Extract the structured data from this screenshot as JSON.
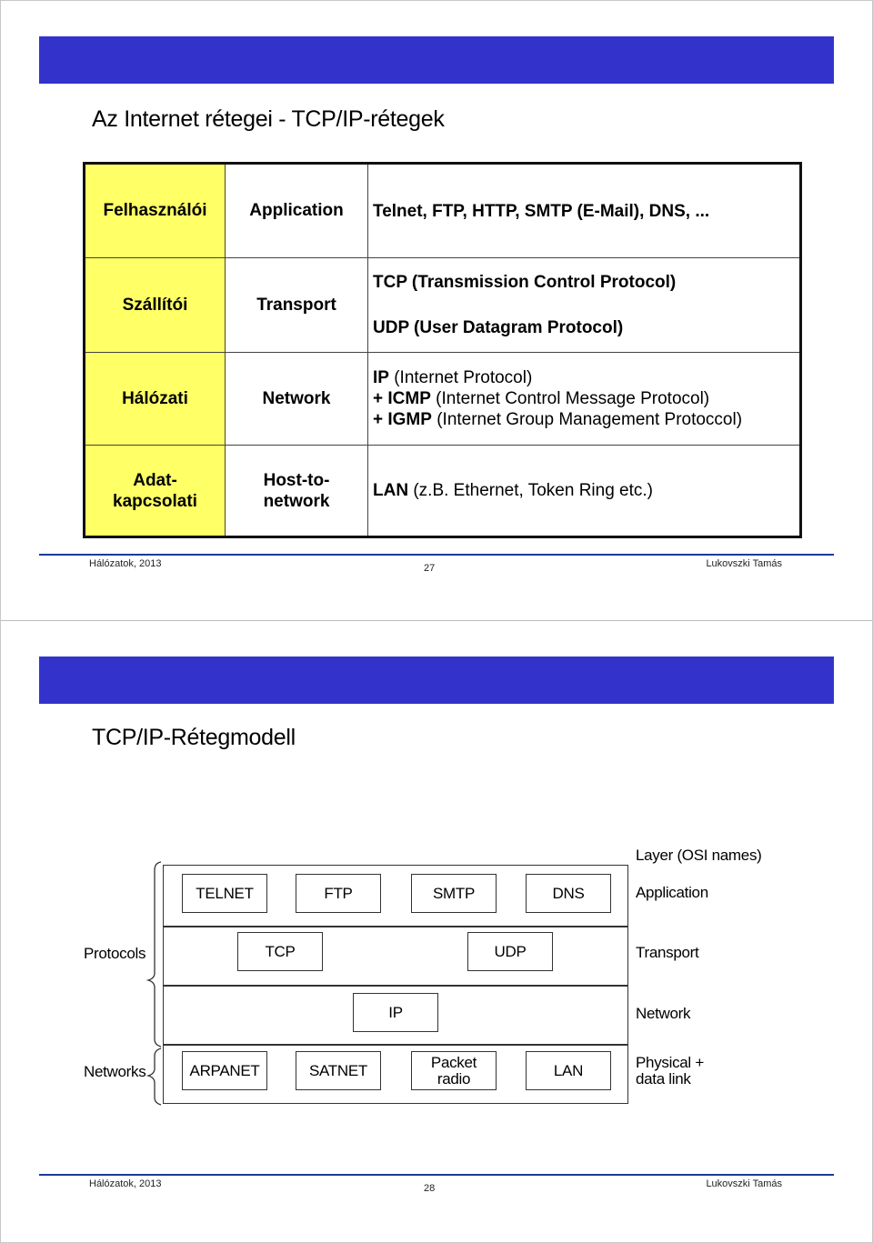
{
  "slides": [
    {
      "title": "Az Internet rétegei - TCP/IP-rétegek",
      "table": {
        "rows": [
          {
            "hungarian": "Felhasználói",
            "english": "Application",
            "protocols": [
              "Telnet, FTP, HTTP, SMTP (E-Mail), DNS, ..."
            ]
          },
          {
            "hungarian": "Szállítói",
            "english": "Transport",
            "protocols": [
              "TCP (Transmission Control Protocol)",
              "UDP (User Datagram Protocol)"
            ]
          },
          {
            "hungarian": "Hálózati",
            "english": "Network",
            "protocols": [
              {
                "prefix": "IP",
                "rest": " (Internet Protocol)"
              },
              {
                "prefix": "+ ICMP",
                "rest": " (Internet Control Message Protocol)"
              },
              {
                "prefix": "+ IGMP",
                "rest": " (Internet  Group Management Protoccol)"
              }
            ]
          },
          {
            "hungarian_line1": "Adat-",
            "hungarian_line2": "kapcsolati",
            "english_line1": "Host-to-",
            "english_line2": "network",
            "protocols": [
              {
                "prefix": "LAN",
                "rest": " (z.B. Ethernet, Token Ring etc.)"
              }
            ]
          }
        ]
      },
      "footer": {
        "left": "Hálózatok, 2013",
        "page": "27",
        "right": "Lukovszki Tamás"
      }
    },
    {
      "title": "TCP/IP-Rétegmodell",
      "diagram": {
        "header": "Layer (OSI names)",
        "layers": [
          {
            "name": "Application",
            "boxes": [
              "TELNET",
              "FTP",
              "SMTP",
              "DNS"
            ]
          },
          {
            "name": "Transport",
            "boxes": [
              "TCP",
              "UDP"
            ]
          },
          {
            "name": "Network",
            "boxes": [
              "IP"
            ]
          },
          {
            "name_line1": "Physical +",
            "name_line2": "data link",
            "boxes": [
              "ARPANET",
              "SATNET",
              "Packet radio",
              "LAN"
            ]
          }
        ],
        "packet_radio_line1": "Packet",
        "packet_radio_line2": "radio",
        "groups": {
          "protocols": "Protocols",
          "networks": "Networks"
        }
      },
      "footer": {
        "left": "Hálózatok, 2013",
        "page": "28",
        "right": "Lukovszki Tamás"
      }
    }
  ],
  "colors": {
    "banner": "#3333cc",
    "highlight_column": "#ffff66",
    "footer_rule": "#1a3a9c"
  }
}
